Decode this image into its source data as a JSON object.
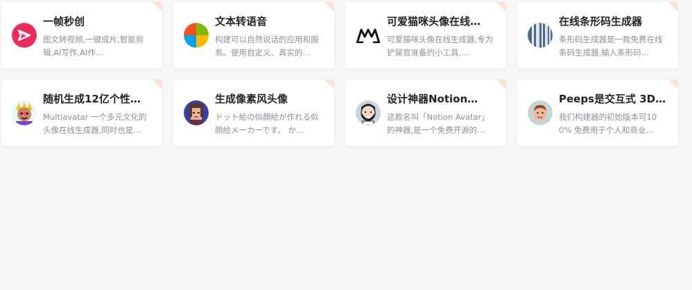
{
  "cards": [
    {
      "title": "一帧秒创",
      "desc": "图文转视频,一键成片,智能剪辑,AI写作,AI作…",
      "icon": "yizhen-logo-icon",
      "accent": "#ee2a5b"
    },
    {
      "title": "文本转语音",
      "desc": "构建可以自然说话的应用和服务。使用自定义、真实的…",
      "icon": "microsoft-logo-icon",
      "accent": "#f25022"
    },
    {
      "title": "可爱猫咪头像在线…",
      "desc": "可爱猫咪头像在线生成器,专为铲屎官准备的小工具,…",
      "icon": "cat-m-logo-icon",
      "accent": "#111111"
    },
    {
      "title": "在线条形码生成器",
      "desc": "条形码生成器是一款免费在线条码生成器,输入条形码…",
      "icon": "barcode-avatar-icon",
      "accent": "#4d6a84"
    },
    {
      "title": "随机生成12亿个性…",
      "desc": "Multiavatar 一个多元文化的头像在线生成器,同时也是…",
      "icon": "multiavatar-icon",
      "accent": "#f5c518"
    },
    {
      "title": "生成像素风头像",
      "desc": "ドット絵の似顔絵が作れる似顔絵メーカーです。 か…",
      "icon": "pixel-face-icon",
      "accent": "#3a3fa8"
    },
    {
      "title": "设计神器Notion…",
      "desc": "这款名叫「Notion Avatar」的神器,是一个免费开源的…",
      "icon": "notion-avatar-icon",
      "accent": "#c9d4e0"
    },
    {
      "title": "Peeps是交互式 3D…",
      "desc": "我们构建器的初始版本可100% 免费用于个人和商业…",
      "icon": "peeps-3d-face-icon",
      "accent": "#c8d3d6"
    }
  ]
}
